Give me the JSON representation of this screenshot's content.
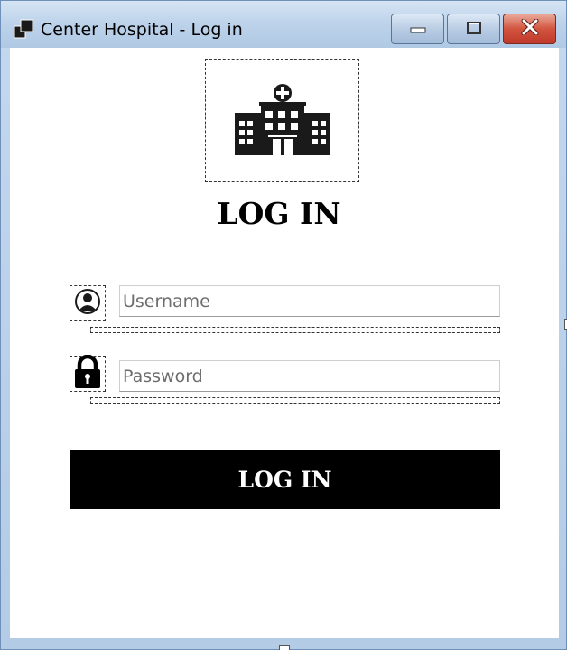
{
  "window": {
    "title": "Center Hospital - Log in",
    "controls": {
      "minimize_icon": "minimize-icon",
      "maximize_icon": "maximize-icon",
      "close_icon": "close-icon"
    }
  },
  "form": {
    "logo_icon": "hospital-icon",
    "heading": "LOG IN",
    "username": {
      "placeholder": "Username",
      "value": "",
      "icon": "user-icon"
    },
    "password": {
      "placeholder": "Password",
      "value": "",
      "icon": "lock-icon"
    },
    "submit_label": "LOG IN"
  },
  "colors": {
    "button_bg": "#000000",
    "button_text": "#ffffff",
    "close_button": "#c0382a"
  }
}
